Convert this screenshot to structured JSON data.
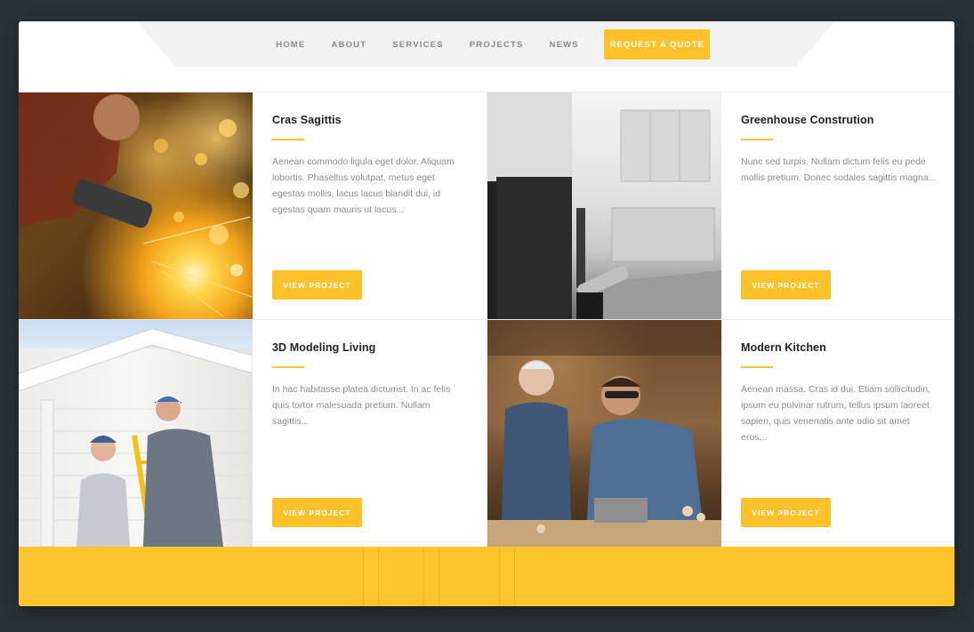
{
  "nav": {
    "links": [
      "HOME",
      "ABOUT",
      "SERVICES",
      "PROJECTS",
      "NEWS"
    ],
    "quote_button": "REQUEST A QUOTE"
  },
  "projects": [
    {
      "title": "Cras Sagittis",
      "text": "Aenean commodo ligula eget dolor. Aliquam lobortis. Phasellus volutpat, metus eget egestas mollis, lacus lacus blandit dui, id egestas quam mauris ut lacus...",
      "button": "VIEW PROJECT",
      "image": "welder-sparks-photo"
    },
    {
      "title": "Greenhouse Constrution",
      "text": "Nunc sed turpis. Nullam dictum felis eu pede mollis pretium. Donec sodales sagittis magna...",
      "button": "VIEW PROJECT",
      "image": "painter-kitchen-photo"
    },
    {
      "title": "3D Modeling Living",
      "text": "In hac habitasse platea dictumst. In ac felis quis tortor malesuada pretium. Nullam sagittis...",
      "button": "VIEW PROJECT",
      "image": "couple-ladder-house-photo"
    },
    {
      "title": "Modern Kitchen",
      "text": "Aenean massa. Cras id dui. Etiam sollicitudin, ipsum eu pulvinar rutrum, tellus ipsum laoreet sapien, quis venenatis ante odio sit amet eros...",
      "button": "VIEW PROJECT",
      "image": "carpenters-workshop-photo"
    }
  ],
  "colors": {
    "accent": "#fdc12a",
    "backdrop": "#2c3338",
    "heading": "#222222",
    "body_text": "#8b8b8b",
    "nav_text": "#8a8a8a"
  }
}
